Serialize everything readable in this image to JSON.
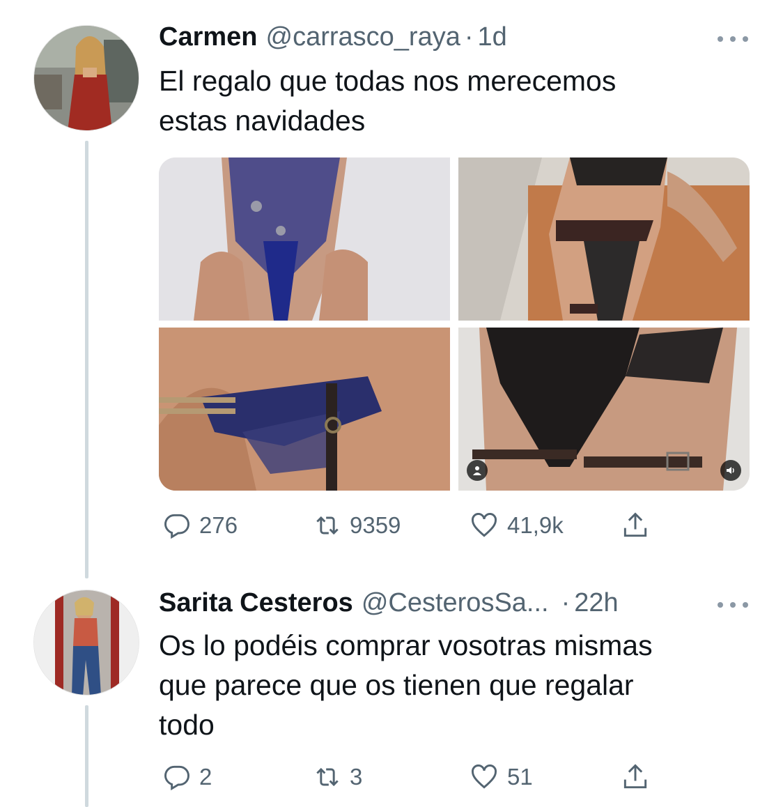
{
  "tweets": [
    {
      "name": "Carmen",
      "handle": "@carrasco_raya",
      "separator": "·",
      "time": "1d",
      "text": "El regalo que todas nos merecemos\nestas navidades",
      "stats": {
        "replies": "276",
        "retweets": "9359",
        "likes": "41,9k"
      }
    },
    {
      "name": "Sarita Cesteros",
      "handle": "@CesterosSa...",
      "separator": "·",
      "time": "22h",
      "text": "Os lo podéis comprar vosotras mismas\nque parece que os tienen que regalar\ntodo",
      "stats": {
        "replies": "2",
        "retweets": "3",
        "likes": "51"
      }
    }
  ],
  "icons": {
    "reply": "reply-icon",
    "retweet": "retweet-icon",
    "like": "heart-icon",
    "share": "share-icon",
    "more": "more-icon"
  },
  "colors": {
    "text": "#0f1419",
    "secondary": "#536471",
    "thread": "#cfd9de"
  }
}
